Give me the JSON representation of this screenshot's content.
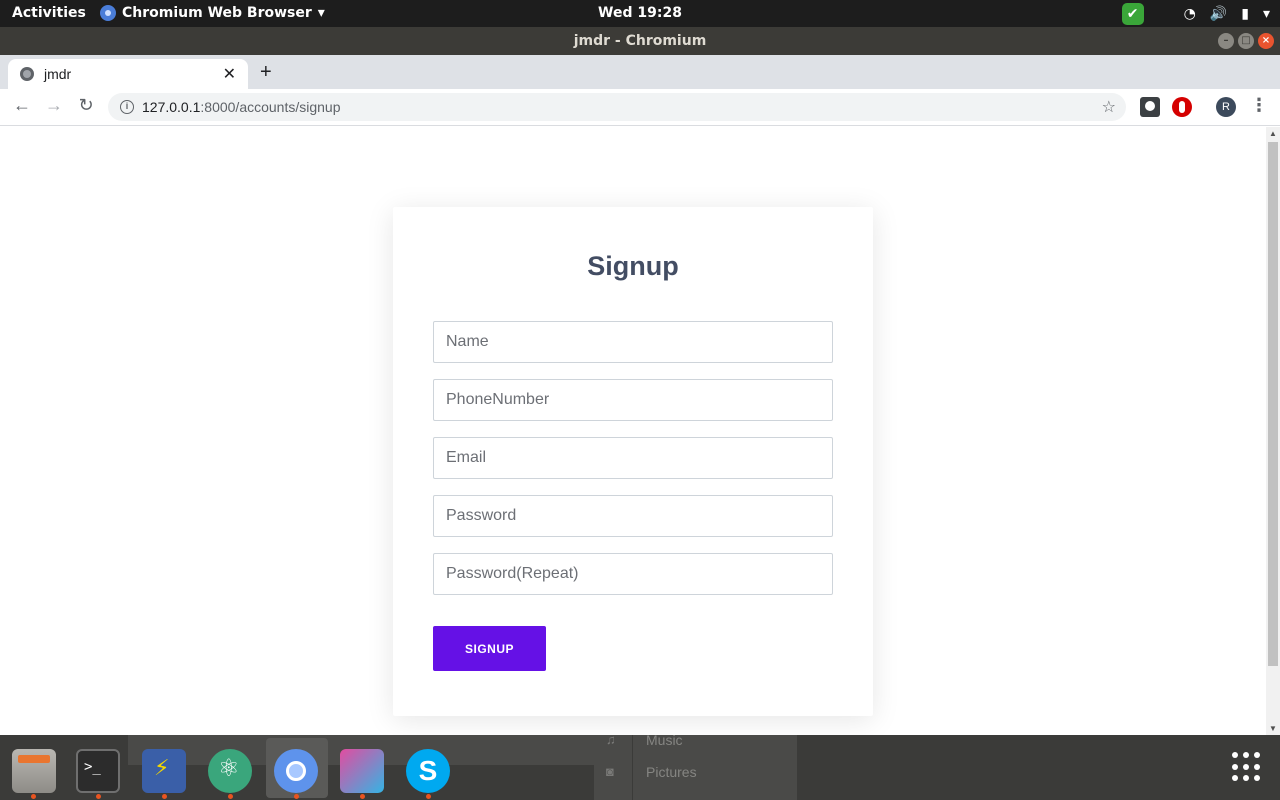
{
  "topbar": {
    "activities": "Activities",
    "app_menu": "Chromium Web Browser",
    "clock": "Wed 19:28"
  },
  "window": {
    "title": "jmdr - Chromium"
  },
  "tabs": [
    {
      "label": "jmdr",
      "icon": "globe-icon",
      "active": true
    }
  ],
  "address_bar": {
    "host": "127.0.0.1",
    "path": ":8000/accounts/signup"
  },
  "profile": {
    "initial": "R"
  },
  "form": {
    "heading": "Signup",
    "fields": {
      "name": {
        "placeholder": "Name"
      },
      "phone": {
        "placeholder": "PhoneNumber"
      },
      "email": {
        "placeholder": "Email"
      },
      "password": {
        "placeholder": "Password"
      },
      "password_repeat": {
        "placeholder": "Password(Repeat)"
      }
    },
    "submit_label": "SIGNUP"
  },
  "dock": {
    "apps": [
      "files-icon",
      "terminal-icon",
      "network-icon",
      "atom-icon",
      "chromium-icon",
      "screenshot-icon",
      "skype-icon"
    ],
    "menu_items": [
      "Music",
      "Pictures"
    ]
  },
  "colors": {
    "accent_button": "#6511e6",
    "heading": "#434d63",
    "topbar": "#1d1d1d",
    "titlebar": "#3c3b37"
  }
}
